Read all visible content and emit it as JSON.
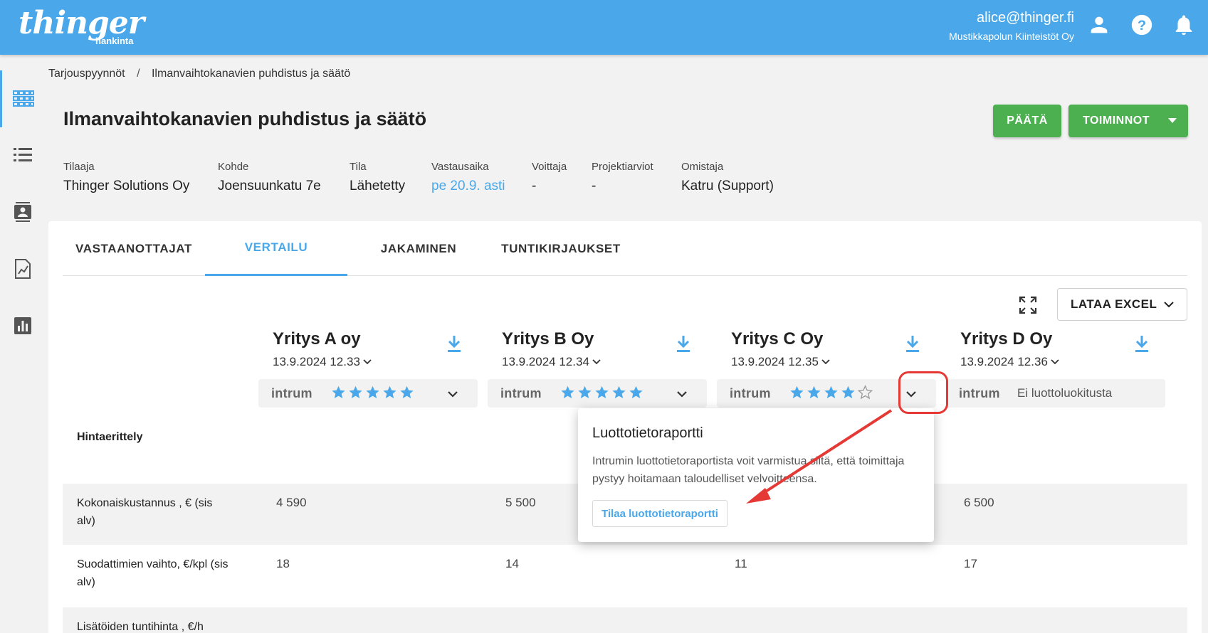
{
  "app": {
    "logo_main": "thinger",
    "logo_sub": "hankinta",
    "user_email": "alice@thinger.fi",
    "user_org": "Mustikkapolun Kiinteistöt Oy"
  },
  "breadcrumb": {
    "items": [
      "Tarjouspyynnöt",
      "Ilmanvaihtokanavien puhdistus ja säätö"
    ],
    "separator": "/"
  },
  "header": {
    "title": "Ilmanvaihtokanavien puhdistus ja säätö",
    "decide_label": "PÄÄTÄ",
    "actions_label": "TOIMINNOT",
    "meta": [
      {
        "label": "Tilaaja",
        "value": "Thinger Solutions Oy"
      },
      {
        "label": "Kohde",
        "value": "Joensuunkatu 7e"
      },
      {
        "label": "Tila",
        "value": "Lähetetty"
      },
      {
        "label": "Vastausaika",
        "value": "pe 20.9. asti"
      },
      {
        "label": "Voittaja",
        "value": "-"
      },
      {
        "label": "Projektiarviot",
        "value": "-"
      },
      {
        "label": "Omistaja",
        "value": "Katru (Support)"
      }
    ]
  },
  "tabs": [
    {
      "label": "VASTAANOTTAJAT",
      "active": false
    },
    {
      "label": "VERTAILU",
      "active": true
    },
    {
      "label": "JAKAMINEN",
      "active": false
    },
    {
      "label": "TUNTIKIRJAUKSET",
      "active": false
    }
  ],
  "toolbar": {
    "excel_label": "LATAA EXCEL"
  },
  "companies": [
    {
      "name": "Yritys A oy",
      "date": "13.9.2024 12.33",
      "provider": "intrum",
      "stars": 5,
      "rating_text": ""
    },
    {
      "name": "Yritys B Oy",
      "date": "13.9.2024 12.34",
      "provider": "intrum",
      "stars": 5,
      "rating_text": ""
    },
    {
      "name": "Yritys C Oy",
      "date": "13.9.2024 12.35",
      "provider": "intrum",
      "stars": 4,
      "rating_text": ""
    },
    {
      "name": "Yritys D Oy",
      "date": "13.9.2024 12.36",
      "provider": "intrum",
      "stars": 0,
      "rating_text": "Ei luottoluokitusta"
    }
  ],
  "table": {
    "section_label": "Hintaerittely",
    "rows": [
      {
        "label": "Kokonaiskustannus , € (sis alv)",
        "values": [
          "4 590",
          "5 500",
          "",
          "6 500"
        ]
      },
      {
        "label": "Suodattimien vaihto, €/kpl (sis alv)",
        "values": [
          "18",
          "14",
          "11",
          "17"
        ]
      },
      {
        "label": "Lisätöiden tuntihinta , €/h",
        "values": [
          "",
          "",
          "",
          ""
        ]
      }
    ]
  },
  "popover": {
    "title": "Luottotietoraportti",
    "text": "Intrumin luottotietoraportista voit varmistua siitä, että toimittaja pystyy hoitamaan taloudelliset velvoitteensa.",
    "button_label": "Tilaa luottotietoraportti"
  },
  "colors": {
    "topbar": "#4aa8ea",
    "accent": "#4aa8ea",
    "green": "#4caf50",
    "annotation": "#e53935"
  },
  "icons": [
    "user-icon",
    "help-icon",
    "bell-icon",
    "grid-icon",
    "list-icon",
    "contacts-icon",
    "report-icon",
    "chart-icon",
    "fullscreen-icon",
    "download-icon",
    "chevron-down-icon",
    "star-icon"
  ]
}
